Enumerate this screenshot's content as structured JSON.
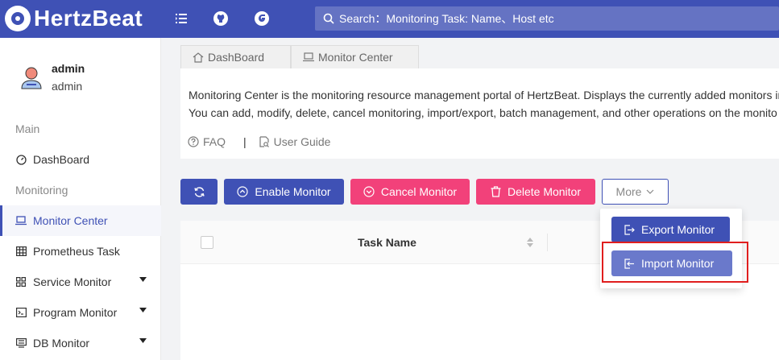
{
  "header": {
    "brand": "HertzBeat",
    "search_placeholder": "Search：Monitoring Task: Name、Host etc",
    "icons": [
      "menu-fold-icon",
      "github-icon",
      "gitee-icon",
      "search-icon"
    ]
  },
  "user": {
    "name": "admin",
    "role": "admin"
  },
  "sidebar": {
    "group_main": "Main",
    "group_monitoring": "Monitoring",
    "items": [
      {
        "label": "DashBoard",
        "icon": "dashboard-icon"
      },
      {
        "label": "Monitor Center",
        "icon": "laptop-icon"
      },
      {
        "label": "Prometheus Task",
        "icon": "table-icon"
      },
      {
        "label": "Service Monitor",
        "icon": "appstore-icon"
      },
      {
        "label": "Program Monitor",
        "icon": "code-icon"
      },
      {
        "label": "DB Monitor",
        "icon": "database-icon"
      }
    ]
  },
  "tabs": [
    {
      "label": "DashBoard",
      "icon": "home-icon"
    },
    {
      "label": "Monitor Center",
      "icon": "laptop-icon"
    }
  ],
  "info": {
    "line1": "Monitoring Center is the monitoring resource management portal of HertzBeat. Displays the currently added monitors in",
    "line2": "You can add, modify, delete, cancel monitoring, import/export, batch management, and other operations on the monito",
    "faq": "FAQ",
    "separator": "|",
    "guide": "User Guide"
  },
  "toolbar": {
    "enable": "Enable Monitor",
    "cancel": "Cancel Monitor",
    "delete": "Delete Monitor",
    "more": "More"
  },
  "table": {
    "header_task_name": "Task Name"
  },
  "dropdown": {
    "export": "Export Monitor",
    "import": "Import Monitor"
  },
  "colors": {
    "primary": "#3f51b5",
    "danger": "#f2417a",
    "highlight": "#e01e1e"
  }
}
